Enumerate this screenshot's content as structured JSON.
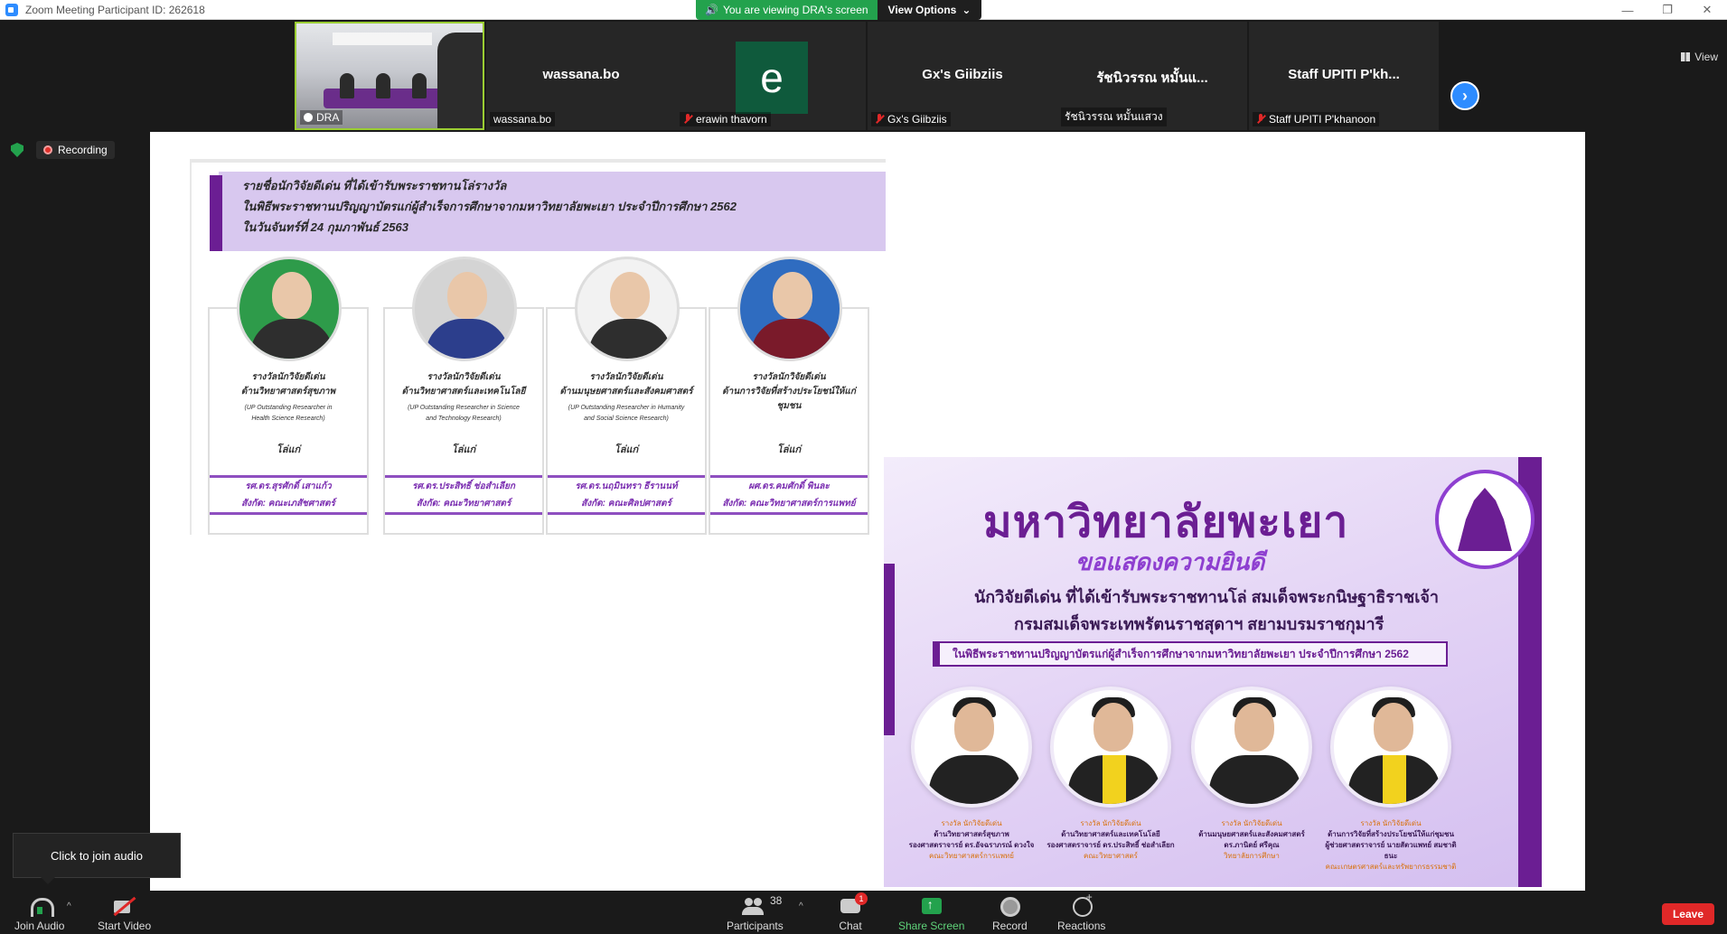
{
  "window": {
    "title": "Zoom Meeting Participant ID: 262618",
    "viewing_banner": "You are viewing DRA's screen",
    "view_options": "View Options",
    "controls": [
      "—",
      "❐",
      "✕"
    ]
  },
  "strip": {
    "tiles": [
      {
        "center": "",
        "label": "DRA"
      },
      {
        "center": "wassana.bo",
        "label": "wassana.bo"
      },
      {
        "center": "e",
        "label": "erawin thavorn"
      },
      {
        "center": "Gx's Giibziis",
        "label": "Gx's Giibziis"
      },
      {
        "center": "รัชนิวรรณ หมั้นแ...",
        "label": "รัชนิวรรณ หมั้นแสวง"
      },
      {
        "center": "Staff UPITI P'kh...",
        "label": "Staff UPITI P'khanoon"
      }
    ],
    "view_label": "View"
  },
  "recording": "Recording",
  "slide1": {
    "header": [
      "รายชื่อนักวิจัยดีเด่น ที่ได้เข้ารับพระราชทานโล่รางวัล",
      "ในพิธีพระราชทานปริญญาบัตรแก่ผู้สำเร็จการศึกษาจากมหาวิทยาลัยพะเยา ประจำปีการศึกษา 2562",
      "ในวันจันทร์ที่ 24 กุมภาพันธ์ 2563"
    ],
    "cards": [
      {
        "award": [
          "รางวัลนักวิจัยดีเด่น",
          "ด้านวิทยาศาสตร์สุขภาพ"
        ],
        "sub": [
          "(UP Outstanding Researcher in",
          "Health Science Research)"
        ],
        "prize": "โล่แก่",
        "name": [
          "รศ.ดร.สุรศักดิ์ เสาแก้ว",
          "สังกัด: คณะเภสัชศาสตร์"
        ]
      },
      {
        "award": [
          "รางวัลนักวิจัยดีเด่น",
          "ด้านวิทยาศาสตร์และเทคโนโลยี"
        ],
        "sub": [
          "(UP Outstanding Researcher in Science",
          "and Technology Research)"
        ],
        "prize": "โล่แก่",
        "name": [
          "รศ.ดร.ประสิทธิ์ ช่อสำเลียก",
          "สังกัด: คณะวิทยาศาสตร์"
        ]
      },
      {
        "award": [
          "รางวัลนักวิจัยดีเด่น",
          "ด้านมนุษยศาสตร์และสังคมศาสตร์"
        ],
        "sub": [
          "(UP Outstanding Researcher in Humanity",
          "and Social Science Research)"
        ],
        "prize": "โล่แก่",
        "name": [
          "รศ.ดร.นฤมินทรา ธีรานนท์",
          "สังกัด: คณะศิลปศาสตร์"
        ]
      },
      {
        "award": [
          "รางวัลนักวิจัยดีเด่น",
          "ด้านการวิจัยที่สร้างประโยชน์ให้แก่ชุมชน"
        ],
        "sub": [
          "",
          ""
        ],
        "prize": "โล่แก่",
        "name": [
          "ผศ.ดร.คมศักดิ์ พินละ",
          "สังกัด: คณะวิทยาศาสตร์การแพทย์"
        ]
      }
    ]
  },
  "slide2": {
    "title": "มหาวิทยาลัยพะเยา",
    "congrats": "ขอแสดงความยินดี",
    "line1": "นักวิจัยดีเด่น ที่ได้เข้ารับพระราชทานโล่ สมเด็จพระกนิษฐาธิราชเจ้า",
    "line2": "กรมสมเด็จพระเทพรัตนราชสุดาฯ สยามบรมราชกุมารี",
    "ceremony": "ในพิธีพระราชทานปริญญาบัตรแก่ผู้สำเร็จการศึกษาจากมหาวิทยาลัยพะเยา ประจำปีการศึกษา 2562",
    "people": [
      {
        "award": "รางวัล นักวิจัยดีเด่น",
        "field": "ด้านวิทยาศาสตร์สุขภาพ",
        "name": "รองศาสตราจารย์ ดร.อัจฉราภรณ์ ดวงใจ",
        "org": "คณะวิทยาศาสตร์การแพทย์"
      },
      {
        "award": "รางวัล นักวิจัยดีเด่น",
        "field": "ด้านวิทยาศาสตร์และเทคโนโลยี",
        "name": "รองศาสตราจารย์ ดร.ประสิทธิ์ ช่อสำเลียก",
        "org": "คณะวิทยาศาสตร์"
      },
      {
        "award": "รางวัล นักวิจัยดีเด่น",
        "field": "ด้านมนุษยศาสตร์และสังคมศาสตร์",
        "name": "ดร.ภานิตย์ ศรีคุณ",
        "org": "วิทยาลัยการศึกษา"
      },
      {
        "award": "รางวัล นักวิจัยดีเด่น",
        "field": "ด้านการวิจัยที่สร้างประโยชน์ให้แก่ชุมชน",
        "name": "ผู้ช่วยศาสตราจารย์ นายสัตวแพทย์ สมชาติ ธนะ",
        "org": "คณะเกษตรศาสตร์และทรัพยากรธรรมชาติ"
      }
    ]
  },
  "tooltip": "Click to join audio",
  "toolbar": {
    "join_audio": "Join Audio",
    "start_video": "Start Video",
    "participants": "Participants",
    "participants_count": "38",
    "chat": "Chat",
    "chat_badge": "1",
    "share_screen": "Share Screen",
    "record": "Record",
    "reactions": "Reactions",
    "leave": "Leave"
  },
  "colors": {
    "accent": "#2d8cff",
    "green": "#23a24d",
    "purple": "#6b1e93",
    "leave": "#e02828"
  }
}
